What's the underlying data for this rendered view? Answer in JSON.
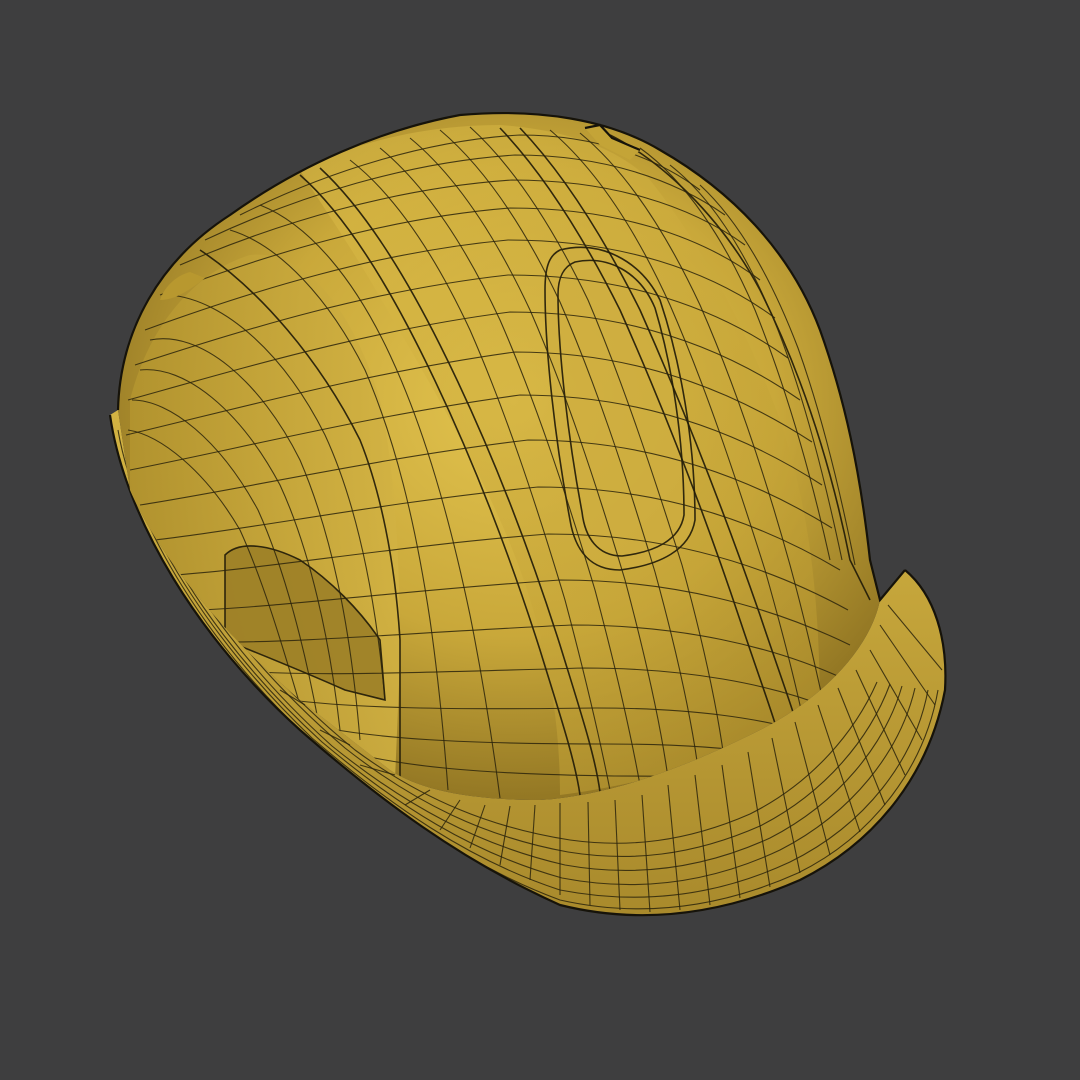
{
  "scene": {
    "background_color": "#3e3e3f",
    "object": "hard-hat",
    "render_mode": "wireframe-on-shaded",
    "shell_color_light": "#e0bf4a",
    "shell_color_mid": "#c9a83a",
    "shell_color_dark": "#8f7422",
    "wire_color": "#2b250c"
  }
}
